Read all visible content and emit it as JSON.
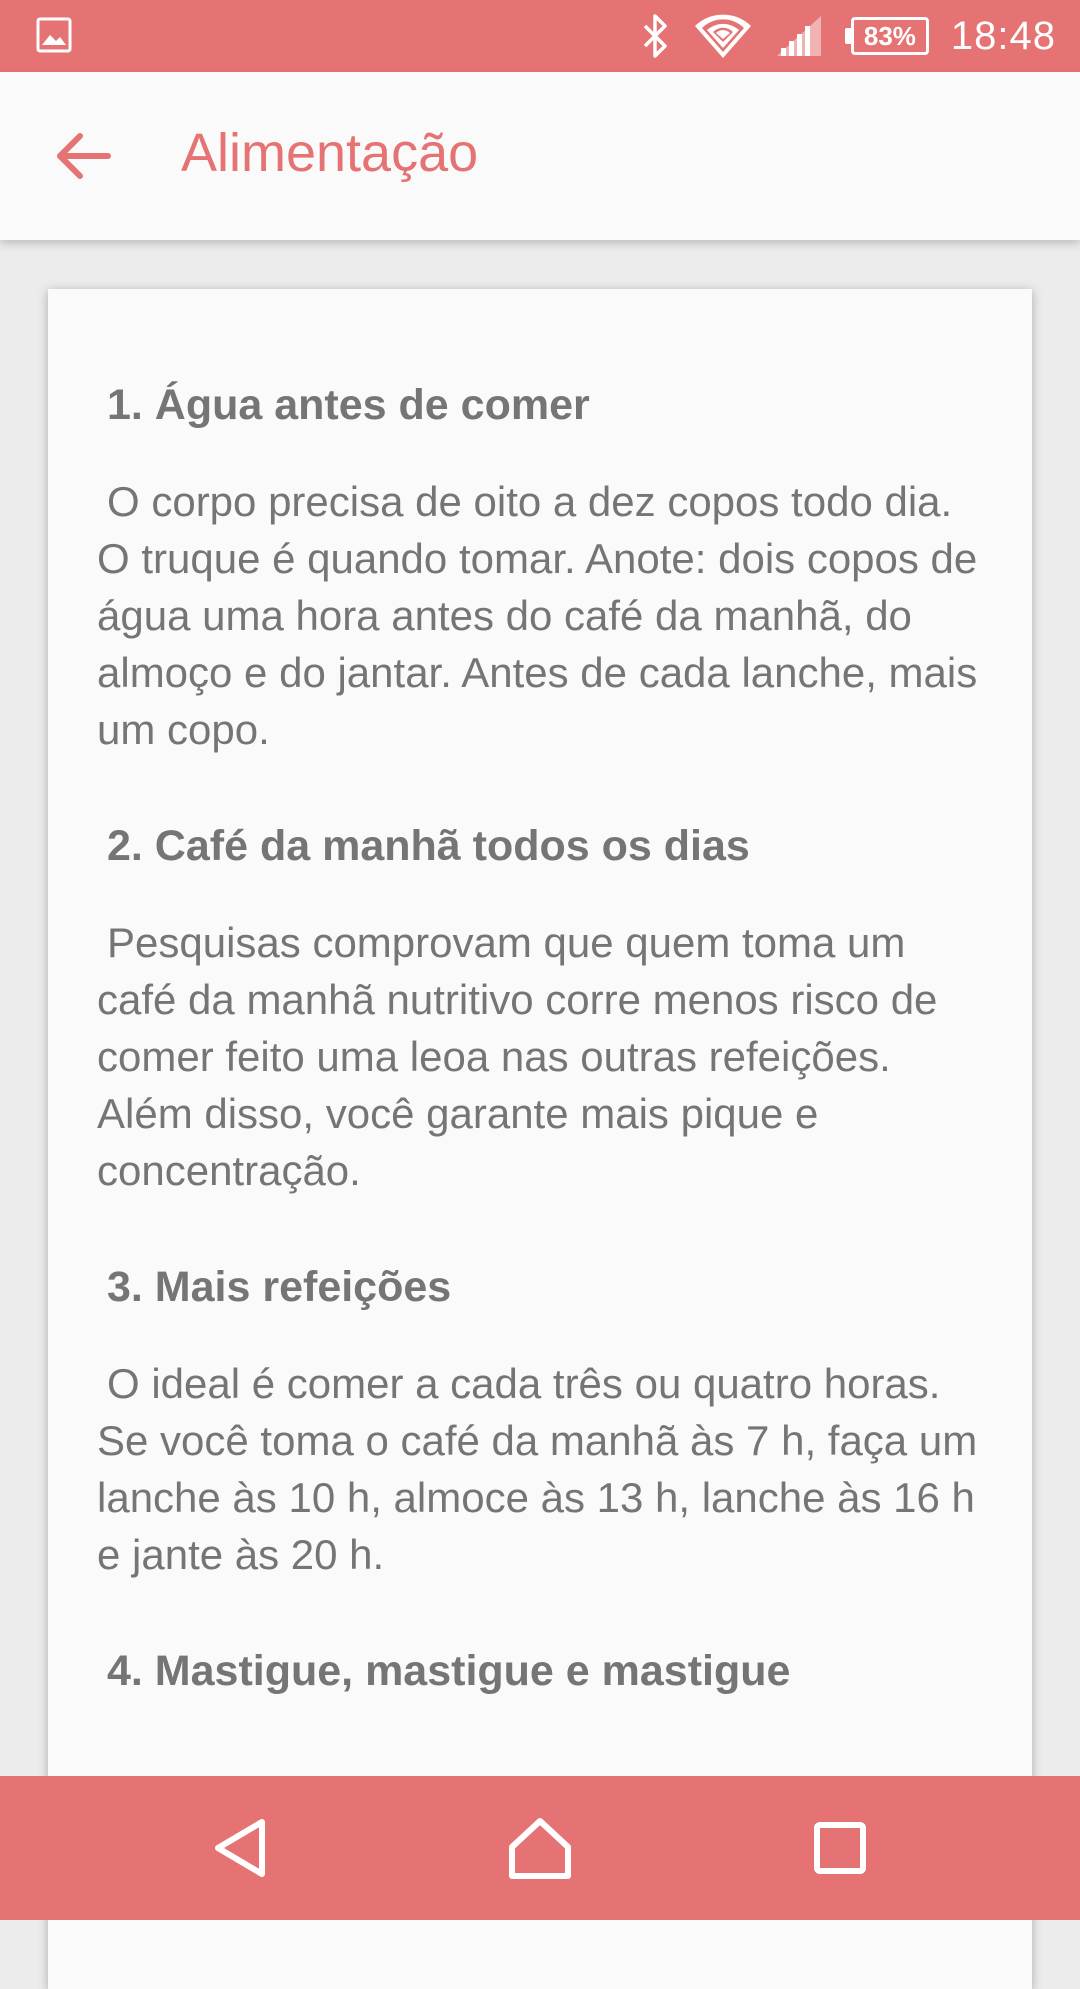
{
  "status_bar": {
    "battery_level": "83%",
    "time": "18:48",
    "icons": [
      "image-icon",
      "bluetooth-icon",
      "wifi-icon",
      "signal-icon",
      "battery-icon"
    ],
    "color": "#e57373"
  },
  "app_bar": {
    "title": "Alimentação",
    "back_icon": "arrow-back-icon",
    "title_color": "#e57373"
  },
  "content": {
    "sections": [
      {
        "heading": "1. Água antes de comer",
        "body": "O corpo precisa de oito a dez copos todo dia. O truque é quando tomar. Anote: dois copos de água uma hora antes do café da manhã, do almoço e do jantar. Antes de cada lanche, mais um copo."
      },
      {
        "heading": "2. Café da manhã todos os dias",
        "body": "Pesquisas comprovam que quem toma um café da manhã nutritivo corre menos risco de comer feito uma leoa nas outras refeições. Além disso, você garante mais pique e concentração."
      },
      {
        "heading": "3. Mais refeições",
        "body": "O ideal é comer a cada três ou quatro horas. Se você toma o café da manhã às 7 h, faça um lanche às 10 h, almoce às 13 h, lanche às 16 h e jante às 20 h."
      },
      {
        "heading": "4. Mastigue, mastigue e mastigue",
        "body": ""
      }
    ]
  },
  "nav_bar": {
    "buttons": [
      "back-triangle-icon",
      "home-icon",
      "recents-square-icon"
    ]
  }
}
